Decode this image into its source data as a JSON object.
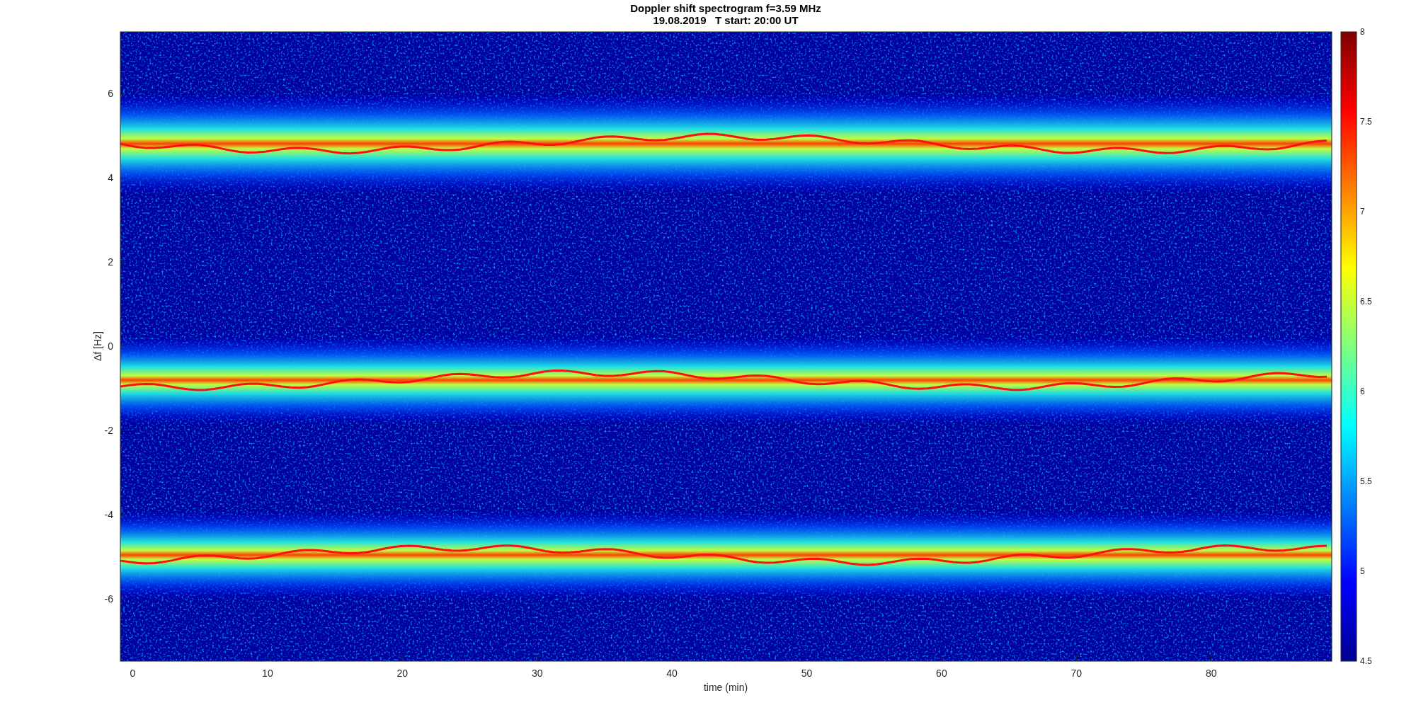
{
  "title": [
    "Doppler shift spectrogram f=3.59 MHz",
    "19.08.2019   T start: 20:00 UT"
  ],
  "xlabel": "time (min)",
  "ylabel": "Δf [Hz]",
  "xticks": [
    "0",
    "10",
    "20",
    "30",
    "40",
    "50",
    "60",
    "70",
    "80"
  ],
  "yticks": [
    "6",
    "4",
    "2",
    "0",
    "-2",
    "-4",
    "-6"
  ],
  "colorbar_ticks": [
    "8",
    "7.5",
    "7",
    "6.5",
    "6",
    "5.5",
    "5",
    "4.5"
  ]
}
